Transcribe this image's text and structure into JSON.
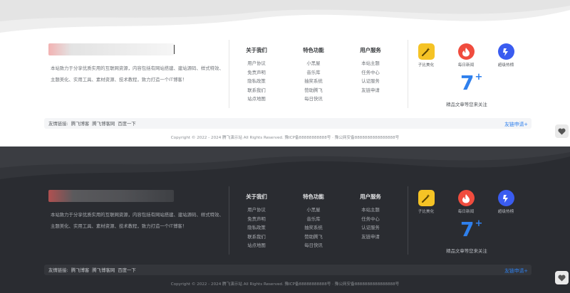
{
  "footer": {
    "intro": "本站致力于分享优质实用的互联网资源，内容包括有网站搭建、建站源码、样式特效、主题美化、实用工具、素材资源、技术教程，致力打造一个IT博客！",
    "columns": [
      {
        "title": "关于我们",
        "items": [
          "用户协议",
          "免责声明",
          "隐私政策",
          "联系我们",
          "站点地图"
        ]
      },
      {
        "title": "特色功能",
        "items": [
          "小黑屋",
          "音乐库",
          "抽奖系统",
          "赞助腾飞",
          "每日快讯"
        ]
      },
      {
        "title": "用户服务",
        "items": [
          "本站主题",
          "任务中心",
          "认证服务",
          "友链申请"
        ]
      }
    ],
    "apps": [
      {
        "label": "子比美化",
        "icon": "magic-wand-icon",
        "color": "#f5c325"
      },
      {
        "label": "每日新闻",
        "icon": "flame-icon",
        "color": "#f04c3e"
      },
      {
        "label": "超级热榜",
        "icon": "lightning-icon",
        "color": "#3a5cf0"
      }
    ],
    "seven": {
      "main": "7",
      "sup": "+"
    },
    "follow_text": "精品文章等您来关注",
    "links_label": "友情链接:",
    "links": [
      "腾飞博客",
      "腾飞博客网",
      "百度一下"
    ],
    "apply_link": "友链申请+",
    "copyright": "Copyright © 2022 - 2024 腾飞演示站 All Rights Reserved. 豫ICP备88888888888号 · 豫公网安备8888888888888888号"
  },
  "colors": {
    "accent": "#2f80ed",
    "dark_bg": "#2a2c31",
    "light_bg": "#ffffff"
  }
}
